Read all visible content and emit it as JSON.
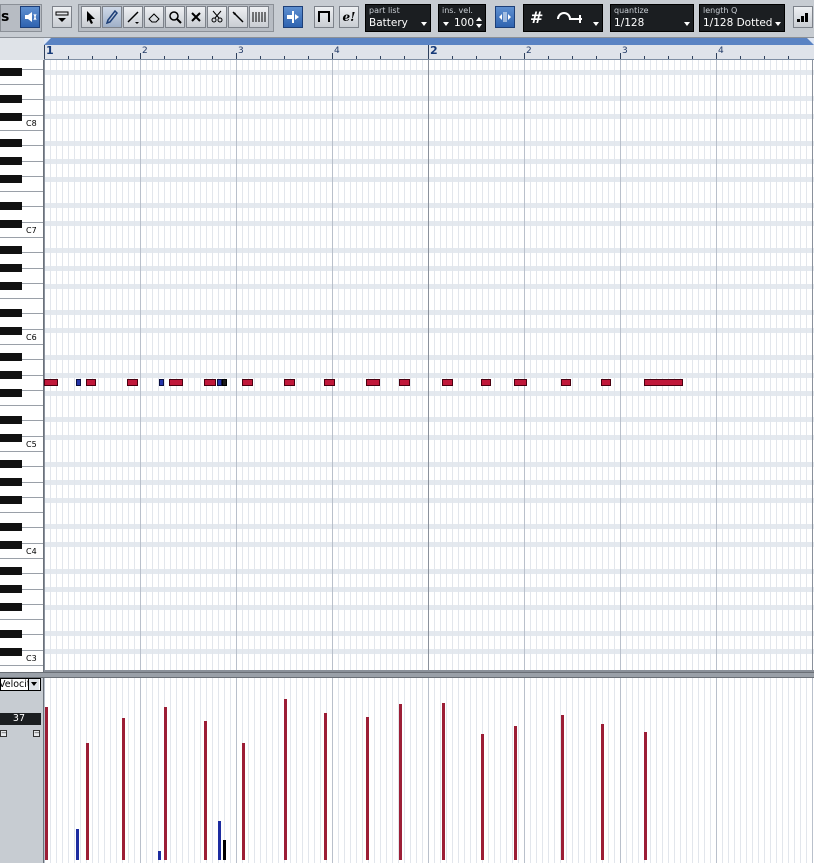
{
  "toolbar": {
    "part_list": {
      "label": "part list",
      "value": "Battery"
    },
    "ins_vel": {
      "label": "ins. vel.",
      "value": "100"
    },
    "quantize": {
      "label": "quantize",
      "value": "1/128"
    },
    "length_q": {
      "label": "length Q",
      "value": "1/128 Dotted"
    },
    "edit_in_place_label": "e!",
    "partial_left_label": "s",
    "snap_label": "#"
  },
  "ruler": {
    "bars": [
      {
        "label": "1",
        "major": true
      },
      {
        "label": "2",
        "major": false
      },
      {
        "label": "3",
        "major": false
      },
      {
        "label": "4",
        "major": false
      },
      {
        "label": "2",
        "major": true
      },
      {
        "label": "2",
        "major": false
      },
      {
        "label": "3",
        "major": false
      },
      {
        "label": "4",
        "major": false
      }
    ]
  },
  "keyboard": {
    "octave_labels": [
      "C8",
      "C7",
      "C6",
      "C5",
      "C4",
      "C3"
    ]
  },
  "notes": [
    {
      "start": 0.0,
      "len": 0.4,
      "color": "red"
    },
    {
      "start": 1.0,
      "len": 0.08,
      "color": "blue"
    },
    {
      "start": 1.3,
      "len": 0.3,
      "color": "red"
    },
    {
      "start": 2.6,
      "len": 0.3,
      "color": "red"
    },
    {
      "start": 3.6,
      "len": 0.08,
      "color": "blue"
    },
    {
      "start": 3.9,
      "len": 0.4,
      "color": "red"
    },
    {
      "start": 5.0,
      "len": 0.35,
      "color": "red"
    },
    {
      "start": 5.4,
      "len": 0.12,
      "color": "blue"
    },
    {
      "start": 5.55,
      "len": 0.1,
      "color": "black"
    },
    {
      "start": 6.2,
      "len": 0.3,
      "color": "red"
    },
    {
      "start": 7.5,
      "len": 0.3,
      "color": "red"
    },
    {
      "start": 8.75,
      "len": 0.3,
      "color": "red"
    },
    {
      "start": 10.05,
      "len": 0.4,
      "color": "red"
    },
    {
      "start": 11.1,
      "len": 0.3,
      "color": "red"
    },
    {
      "start": 12.45,
      "len": 0.3,
      "color": "red"
    },
    {
      "start": 13.65,
      "len": 0.3,
      "color": "red"
    },
    {
      "start": 14.7,
      "len": 0.35,
      "color": "red"
    },
    {
      "start": 16.15,
      "len": 0.3,
      "color": "red"
    },
    {
      "start": 17.4,
      "len": 0.3,
      "color": "red"
    },
    {
      "start": 18.75,
      "len": 1.1,
      "color": "red"
    }
  ],
  "controller": {
    "lane_label": "Velocity",
    "value": "37",
    "velocities": [
      {
        "pos": 0.02,
        "value": 98,
        "color": "red"
      },
      {
        "pos": 1.0,
        "value": 20,
        "color": "blue"
      },
      {
        "pos": 1.3,
        "value": 75,
        "color": "red"
      },
      {
        "pos": 2.45,
        "value": 91,
        "color": "red"
      },
      {
        "pos": 3.55,
        "value": 6,
        "color": "blue"
      },
      {
        "pos": 3.75,
        "value": 98,
        "color": "red"
      },
      {
        "pos": 5.0,
        "value": 89,
        "color": "red"
      },
      {
        "pos": 5.45,
        "value": 25,
        "color": "blue"
      },
      {
        "pos": 5.6,
        "value": 13,
        "color": "black"
      },
      {
        "pos": 6.2,
        "value": 75,
        "color": "red"
      },
      {
        "pos": 7.5,
        "value": 103,
        "color": "red"
      },
      {
        "pos": 8.75,
        "value": 94,
        "color": "red"
      },
      {
        "pos": 10.05,
        "value": 92,
        "color": "red"
      },
      {
        "pos": 11.1,
        "value": 100,
        "color": "red"
      },
      {
        "pos": 12.45,
        "value": 101,
        "color": "red"
      },
      {
        "pos": 13.65,
        "value": 81,
        "color": "red"
      },
      {
        "pos": 14.7,
        "value": 86,
        "color": "red"
      },
      {
        "pos": 16.15,
        "value": 93,
        "color": "red"
      },
      {
        "pos": 17.4,
        "value": 87,
        "color": "red"
      },
      {
        "pos": 18.75,
        "value": 82,
        "color": "red"
      }
    ]
  },
  "colors": {
    "note_red": "#c0183a",
    "note_blue": "#2434a8",
    "vel_red": "#9c1e36",
    "ruler_band": "#5a83c3"
  }
}
